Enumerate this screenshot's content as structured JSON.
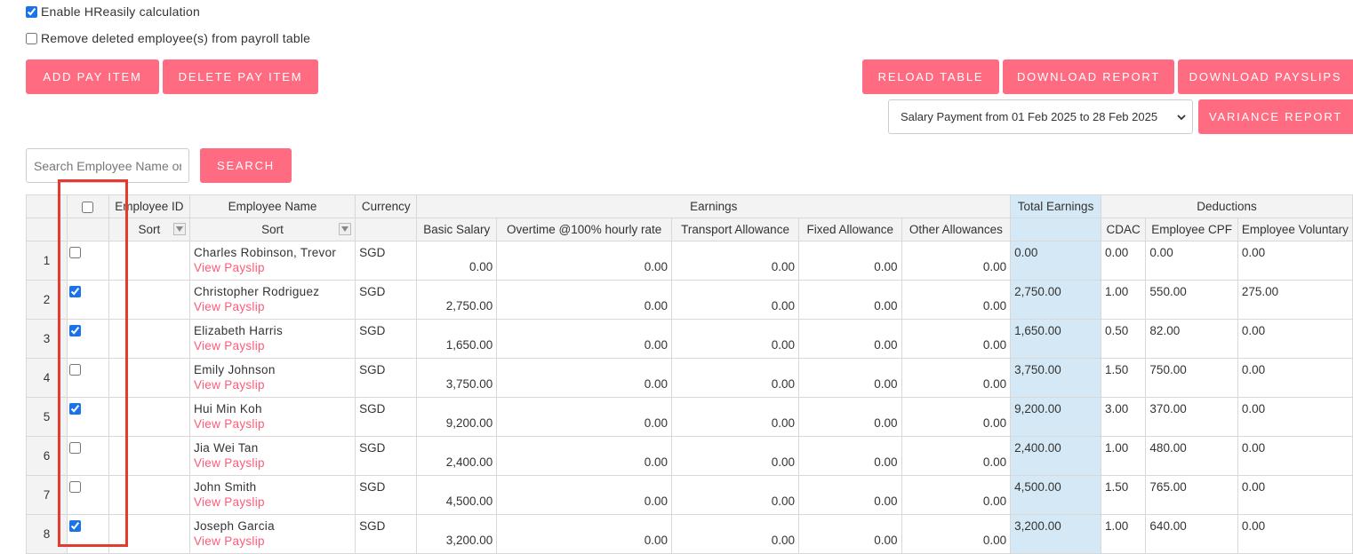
{
  "options": {
    "enable_calc": {
      "label": "Enable HReasily calculation",
      "checked": true
    },
    "remove_deleted": {
      "label": "Remove deleted employee(s) from payroll table",
      "checked": false
    }
  },
  "toolbar": {
    "add_pay_item": "ADD PAY ITEM",
    "delete_pay_item": "DELETE PAY ITEM",
    "reload_table": "RELOAD TABLE",
    "download_report": "DOWNLOAD REPORT",
    "download_payslips": "DOWNLOAD PAYSLIPS",
    "variance_report": "VARIANCE REPORT",
    "period_select": "Salary Payment from 01 Feb 2025 to 28 Feb 2025"
  },
  "search": {
    "placeholder": "Search Employee Name or ID",
    "button": "SEARCH"
  },
  "table": {
    "headers": {
      "employee_id": "Employee ID",
      "employee_name": "Employee Name",
      "currency": "Currency",
      "earnings": "Earnings",
      "total_earnings": "Total Earnings",
      "deductions": "Deductions",
      "sort": "Sort",
      "basic_salary": "Basic Salary",
      "overtime": "Overtime @100% hourly rate",
      "transport": "Transport Allowance",
      "fixed": "Fixed Allowance",
      "other": "Other Allowances",
      "cdac": "CDAC",
      "employee_cpf": "Employee CPF",
      "employee_voluntary": "Employee Voluntary"
    },
    "view_payslip_label": "View Payslip",
    "rows": [
      {
        "num": "1",
        "checked": false,
        "name": "Charles Robinson, Trevor",
        "currency": "SGD",
        "basic": "0.00",
        "overtime": "0.00",
        "transport": "0.00",
        "fixed": "0.00",
        "other": "0.00",
        "total": "0.00",
        "cdac": "0.00",
        "cpf": "0.00",
        "voluntary": "0.00"
      },
      {
        "num": "2",
        "checked": true,
        "name": "Christopher Rodriguez",
        "currency": "SGD",
        "basic": "2,750.00",
        "overtime": "0.00",
        "transport": "0.00",
        "fixed": "0.00",
        "other": "0.00",
        "total": "2,750.00",
        "cdac": "1.00",
        "cpf": "550.00",
        "voluntary": "275.00"
      },
      {
        "num": "3",
        "checked": true,
        "name": "Elizabeth Harris",
        "currency": "SGD",
        "basic": "1,650.00",
        "overtime": "0.00",
        "transport": "0.00",
        "fixed": "0.00",
        "other": "0.00",
        "total": "1,650.00",
        "cdac": "0.50",
        "cpf": "82.00",
        "voluntary": "0.00"
      },
      {
        "num": "4",
        "checked": false,
        "name": "Emily Johnson",
        "currency": "SGD",
        "basic": "3,750.00",
        "overtime": "0.00",
        "transport": "0.00",
        "fixed": "0.00",
        "other": "0.00",
        "total": "3,750.00",
        "cdac": "1.50",
        "cpf": "750.00",
        "voluntary": "0.00"
      },
      {
        "num": "5",
        "checked": true,
        "name": "Hui Min Koh",
        "currency": "SGD",
        "basic": "9,200.00",
        "overtime": "0.00",
        "transport": "0.00",
        "fixed": "0.00",
        "other": "0.00",
        "total": "9,200.00",
        "cdac": "3.00",
        "cpf": "370.00",
        "voluntary": "0.00"
      },
      {
        "num": "6",
        "checked": false,
        "name": "Jia Wei Tan",
        "currency": "SGD",
        "basic": "2,400.00",
        "overtime": "0.00",
        "transport": "0.00",
        "fixed": "0.00",
        "other": "0.00",
        "total": "2,400.00",
        "cdac": "1.00",
        "cpf": "480.00",
        "voluntary": "0.00"
      },
      {
        "num": "7",
        "checked": false,
        "name": "John Smith",
        "currency": "SGD",
        "basic": "4,500.00",
        "overtime": "0.00",
        "transport": "0.00",
        "fixed": "0.00",
        "other": "0.00",
        "total": "4,500.00",
        "cdac": "1.50",
        "cpf": "765.00",
        "voluntary": "0.00"
      },
      {
        "num": "8",
        "checked": true,
        "name": "Joseph Garcia",
        "currency": "SGD",
        "basic": "3,200.00",
        "overtime": "0.00",
        "transport": "0.00",
        "fixed": "0.00",
        "other": "0.00",
        "total": "3,200.00",
        "cdac": "1.00",
        "cpf": "640.00",
        "voluntary": "0.00"
      }
    ]
  },
  "colors": {
    "accent_button": "#ff6b81",
    "payslip_link": "#ff5a78",
    "total_column_bg": "#d4e9f5",
    "highlight_box": "#e53a2d"
  }
}
